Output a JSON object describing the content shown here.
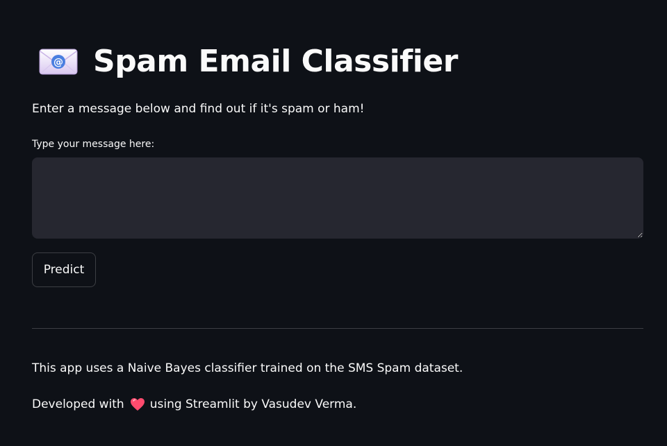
{
  "header": {
    "icon": "email-envelope-icon",
    "title": "Spam Email Classifier"
  },
  "intro_text": "Enter a message below and find out if it's spam or ham!",
  "message_input": {
    "label": "Type your message here:",
    "value": "",
    "placeholder": ""
  },
  "predict_button": {
    "label": "Predict"
  },
  "footer": {
    "description": "This app uses a Naive Bayes classifier trained on the SMS Spam dataset.",
    "developed_prefix": "Developed with",
    "heart_icon": "heart-icon",
    "developed_suffix": "using Streamlit by Vasudev Verma."
  },
  "colors": {
    "background": "#0e1117",
    "input_background": "#262730",
    "text": "#fafafa",
    "heart": "#ff4b6e"
  }
}
